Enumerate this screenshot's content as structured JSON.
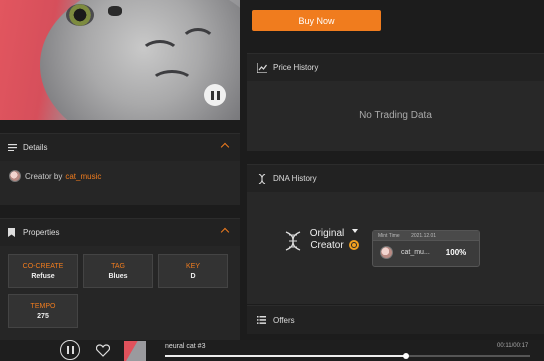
{
  "details": {
    "title": "Details",
    "creator_prefix": "Creator by",
    "creator_name": "cat_music"
  },
  "properties": {
    "title": "Properties",
    "items": [
      {
        "key": "CO-CREATE",
        "value": "Refuse"
      },
      {
        "key": "TAG",
        "value": "Blues"
      },
      {
        "key": "KEY",
        "value": "D"
      },
      {
        "key": "TEMPO",
        "value": "275"
      }
    ]
  },
  "buy": {
    "label": "Buy Now"
  },
  "price_history": {
    "title": "Price History",
    "empty": "No Trading Data"
  },
  "dna_history": {
    "title": "DNA History",
    "original_label": "Original Creator",
    "mint_time_label": "Mint Time",
    "mint_time": "2021.12.01",
    "owner": "cat_mu...",
    "share": "100%"
  },
  "offers": {
    "title": "Offers"
  },
  "player": {
    "track_title": "neural cat #3",
    "time": "00:11/00:17",
    "progress": 0.66
  },
  "colors": {
    "accent": "#f07c1e",
    "background": "#1c1c1c",
    "panel": "#282828"
  }
}
